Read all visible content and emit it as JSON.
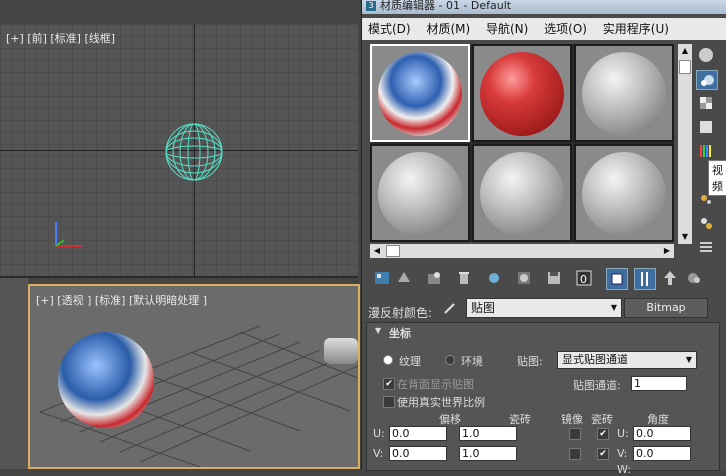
{
  "viewports": {
    "front": {
      "label": "[+] [前] [标准] [线框]"
    },
    "perspective": {
      "label": "[+] [透视 ] [标准] [默认明暗处理 ]"
    }
  },
  "dialog": {
    "title": "材质编辑器 - 01 - Default",
    "title_icon": "3",
    "menu": [
      "模式(D)",
      "材质(M)",
      "导航(N)",
      "选项(O)",
      "实用程序(U)"
    ],
    "tooltip": "视频"
  },
  "params": {
    "diffuse_label": "漫反射颜色:",
    "map_name": "贴图",
    "map_type_button": "Bitmap",
    "rollout_title": "坐标",
    "radio_texture": "纹理",
    "radio_env": "环境",
    "mapping_label": "贴图:",
    "mapping_value": "显式贴图通道",
    "show_back": "在背面显示贴图",
    "channel_label": "贴图通道:",
    "channel_value": "1",
    "real_world": "使用真实世界比例",
    "col_offset": "偏移",
    "col_tiling": "瓷砖",
    "col_mirror": "镜像",
    "col_tile": "瓷砖",
    "col_angle": "角度",
    "u_label": "U:",
    "v_label": "V:",
    "w_label": "W:",
    "u_offset": "0.0",
    "u_tiling": "1.0",
    "u_angle": "0.0",
    "v_offset": "0.0",
    "v_tiling": "1.0",
    "v_angle": "0.0",
    "u_tile_check": "✔",
    "v_tile_check": "✔"
  },
  "colors": {
    "accent_red": "#c8282e",
    "wire": "#55e0c8",
    "active_border": "#ffffff"
  }
}
